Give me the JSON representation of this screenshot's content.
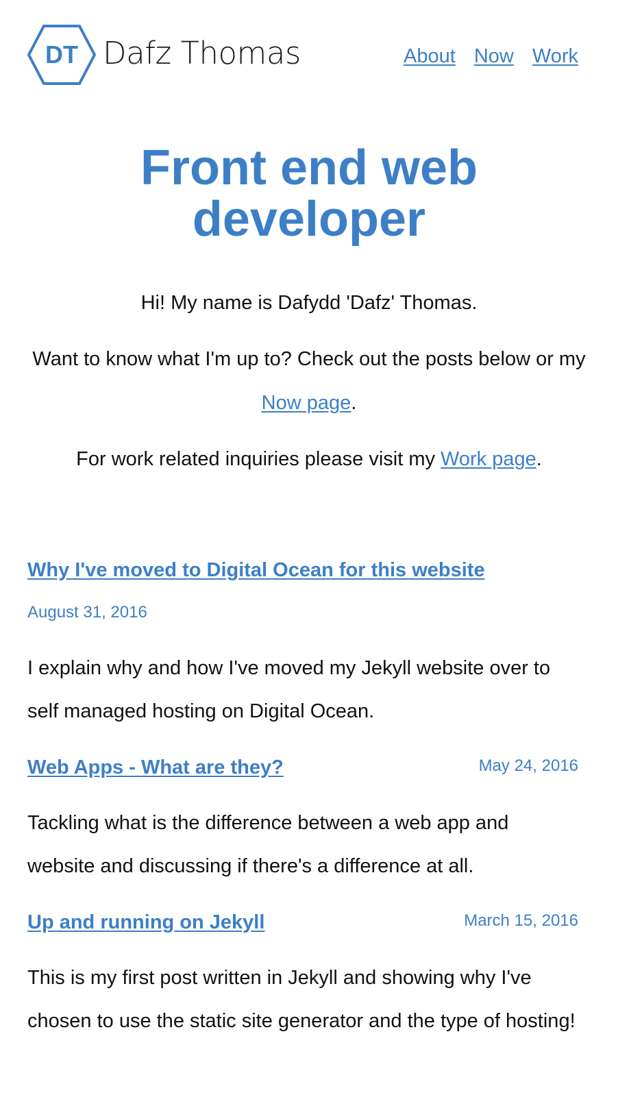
{
  "brand": {
    "initials": "DT",
    "name": "Dafz Thomas",
    "color": "#3d7fc6"
  },
  "nav": {
    "items": [
      {
        "label": "About"
      },
      {
        "label": "Now"
      },
      {
        "label": "Work"
      }
    ]
  },
  "hero": {
    "title_line1": "Front end web",
    "title_line2": "developer"
  },
  "intro": {
    "greeting": "Hi! My name is Dafydd 'Dafz' Thomas.",
    "posts_text": "Want to know what I'm up to? Check out the posts below or my ",
    "now_link": "Now page",
    "posts_end": ".",
    "work_text": "For work related inquiries please visit my ",
    "work_link": "Work page",
    "work_end": "."
  },
  "posts": [
    {
      "title": "Why I've moved to Digital Ocean for this website",
      "date": "August 31, 2016",
      "excerpt": "I explain why and how I've moved my Jekyll website over to self managed hosting on Digital Ocean."
    },
    {
      "title": "Web Apps - What are they?",
      "date": "May 24, 2016",
      "excerpt": "Tackling what is the difference between a web app and website and discussing if there's a difference at all."
    },
    {
      "title": "Up and running on Jekyll",
      "date": "March 15, 2016",
      "excerpt": "This is my first post written in Jekyll and showing why I've chosen to use the static site generator and the type of hosting!"
    }
  ]
}
